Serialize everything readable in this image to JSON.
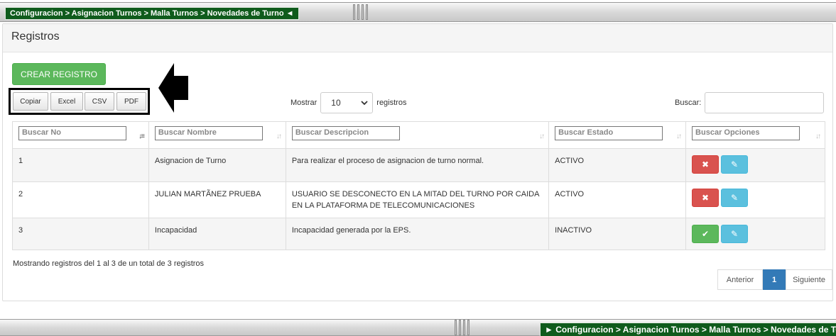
{
  "breadcrumb": {
    "text": "Configuracion > Asignacion Turnos > Malla Turnos > Novedades de Turno",
    "collapse_glyph": "◄",
    "expand_glyph": "►"
  },
  "panel": {
    "title": "Registros"
  },
  "toolbar": {
    "create_label": "CREAR REGISTRO",
    "export": [
      "Copiar",
      "Excel",
      "CSV",
      "PDF"
    ]
  },
  "length": {
    "prefix": "Mostrar",
    "value": "10",
    "suffix": "registros"
  },
  "search": {
    "label": "Buscar:",
    "value": ""
  },
  "table": {
    "filters": [
      "Buscar No",
      "Buscar Nombre",
      "Buscar Descripcion",
      "Buscar Estado",
      "Buscar Opciones"
    ],
    "rows": [
      {
        "no": "1",
        "nombre": "Asignacion de Turno",
        "descripcion": "Para realizar el proceso de asignacion de turno normal.",
        "estado": "ACTIVO",
        "action": "delete"
      },
      {
        "no": "2",
        "nombre": "JULIAN MARTÃNEZ PRUEBA",
        "descripcion": "USUARIO SE DESCONECTO EN LA MITAD DEL TURNO POR CAIDA EN LA PLATAFORMA DE TELECOMUNICACIONES",
        "estado": "ACTIVO",
        "action": "delete"
      },
      {
        "no": "3",
        "nombre": "Incapacidad",
        "descripcion": "Incapacidad generada por la EPS.",
        "estado": "INACTIVO",
        "action": "activate"
      }
    ]
  },
  "info": "Mostrando registros del 1 al 3 de un total de 3 registros",
  "pagination": {
    "prev": "Anterior",
    "current": "1",
    "next": "Siguiente"
  },
  "icons": {
    "delete": "✖",
    "edit": "✎",
    "activate": "✔"
  },
  "colors": {
    "breadcrumb_bg": "#0f5b1c",
    "success": "#5cb85c",
    "danger": "#d9534f",
    "info": "#5bc0de",
    "primary": "#337ab7"
  }
}
